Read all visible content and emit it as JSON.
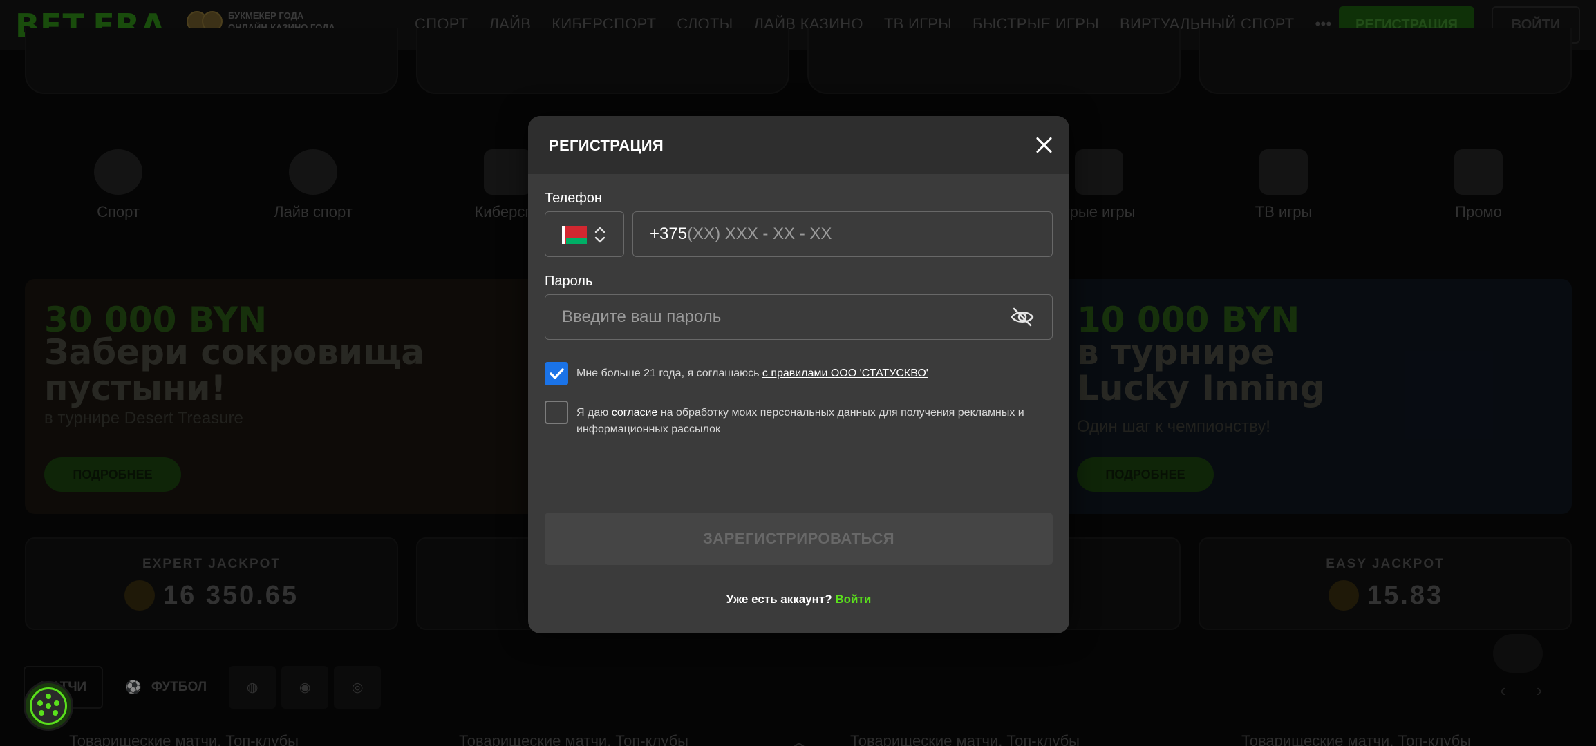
{
  "header": {
    "logo_text": "BET.ERA",
    "badge_line1": "БУКМЕКЕР ГОДА",
    "badge_line2": "ОНЛАЙН-КАЗИНО ГОДА",
    "nav": [
      "СПОРТ",
      "ЛАЙВ",
      "КИБЕРСПОРТ",
      "СЛОТЫ",
      "ЛАЙВ КАЗИНО",
      "ТВ ИГРЫ",
      "БЫСТРЫЕ ИГРЫ",
      "ВИРТУАЛЬНЫЙ СПОРТ",
      "•••"
    ],
    "register_label": "РЕГИСТРАЦИЯ",
    "login_label": "ВОЙТИ"
  },
  "categories": [
    "Спорт",
    "Лайв спорт",
    "Киберспо",
    "",
    "",
    "трые игры",
    "ТВ игры",
    "Промо"
  ],
  "banners": {
    "left": {
      "amount": "30 000 BYN",
      "title_line1": "Забери сокровища",
      "title_line2": "пустыни!",
      "subtitle": "в турнире Desert Treasure",
      "button": "ПОДРОБНЕЕ"
    },
    "right": {
      "amount": "10 000 BYN",
      "title_line1": "в турнире",
      "title_line2": "Lucky Inning",
      "subtitle": "Один шаг к чемпионству!",
      "button": "ПОДРОБНЕЕ"
    }
  },
  "jackpots": {
    "expert": {
      "title": "EXPERT JACKPOT",
      "value": "16 350.65"
    },
    "easy": {
      "title": "EASY JACKPOT",
      "value": "15.83"
    }
  },
  "match_tabs": {
    "all": "МАТЧИ",
    "football": "ФУТБОЛ"
  },
  "rows": [
    "Товарищеские матчи. Топ-клубы",
    "Товарищеские матчи. Топ-клубы",
    "Товарищеские матчи. Топ-клубы",
    "Товарищеские матчи. Топ-клубы"
  ],
  "modal": {
    "title": "РЕГИСТРАЦИЯ",
    "phone_label": "Телефон",
    "phone_prefix": "+375",
    "phone_mask": "(XX) XXX - XX - XX",
    "country": "BY",
    "password_label": "Пароль",
    "password_placeholder": "Введите ваш пароль",
    "age_checkbox": {
      "checked": true,
      "text": "Мне больше 21 года, я соглашаюсь ",
      "link": "с правилами ООО 'СТАТУСКВО'"
    },
    "consent_checkbox": {
      "checked": false,
      "text_before": "Я даю ",
      "link": "согласие",
      "text_after": " на обработку моих персональных данных для получения рекламных и информационных рассылок"
    },
    "submit_label": "ЗАРЕГИСТРИРОВАТЬСЯ",
    "have_account": "Уже есть аккаунт?",
    "login_link": "Войти"
  },
  "colors": {
    "accent_green": "#5ae01c",
    "checkbox_blue": "#1a73e8",
    "modal_bg": "#3b3b3b"
  }
}
